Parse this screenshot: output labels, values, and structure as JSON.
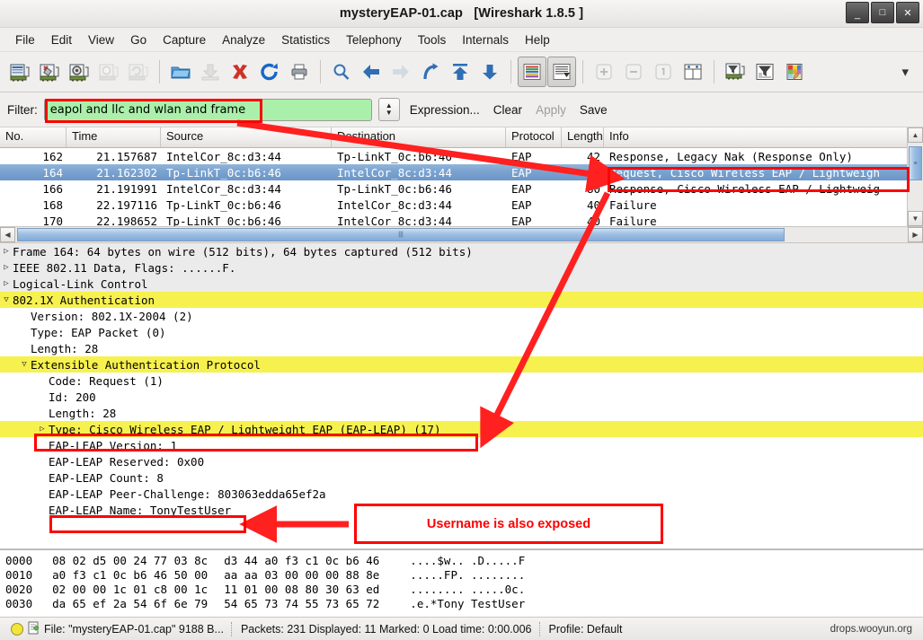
{
  "window": {
    "title": "mysteryEAP-01.cap   [Wireshark 1.8.5 ]",
    "minimize": "_",
    "maximize": "□",
    "close": "✕"
  },
  "menubar": {
    "items": [
      "File",
      "Edit",
      "View",
      "Go",
      "Capture",
      "Analyze",
      "Statistics",
      "Telephony",
      "Tools",
      "Internals",
      "Help"
    ]
  },
  "toolbar": {
    "icons": [
      "interfaces-icon",
      "capture-options-icon",
      "start-capture-icon",
      "stop-capture-icon",
      "restart-capture-icon",
      "open-file-icon",
      "save-file-icon",
      "close-file-icon",
      "reload-icon",
      "print-icon",
      "find-packet-icon",
      "go-back-icon",
      "go-forward-icon",
      "go-to-packet-icon",
      "go-first-packet-icon",
      "go-last-packet-icon",
      "colorize-icon",
      "auto-scroll-icon",
      "zoom-in-icon",
      "zoom-out-icon",
      "zoom-normal-icon",
      "resize-columns-icon",
      "capture-filters-icon",
      "display-filters-icon",
      "coloring-rules-icon"
    ],
    "overflow": "chevron-down-icon"
  },
  "filterbar": {
    "label": "Filter:",
    "value": "eapol and llc and wlan and frame",
    "placeholder": "",
    "expression": "Expression...",
    "clear": "Clear",
    "apply": "Apply",
    "save": "Save"
  },
  "packet_list": {
    "columns": [
      "No.",
      "Time",
      "Source",
      "Destination",
      "Protocol",
      "Length",
      "Info"
    ],
    "rows": [
      {
        "no": "162",
        "time": "21.157687",
        "source": "IntelCor_8c:d3:44",
        "destination": "Tp-LinkT_0c:b6:46",
        "protocol": "EAP",
        "length": "42",
        "info": "Response, Legacy Nak (Response Only)",
        "selected": false
      },
      {
        "no": "164",
        "time": "21.162302",
        "source": "Tp-LinkT_0c:b6:46",
        "destination": "IntelCor_8c:d3:44",
        "protocol": "EAP",
        "length": "64",
        "info": "Request, Cisco Wireless EAP / Lightweigh",
        "selected": true
      },
      {
        "no": "166",
        "time": "21.191991",
        "source": "IntelCor_8c:d3:44",
        "destination": "Tp-LinkT_0c:b6:46",
        "protocol": "EAP",
        "length": "80",
        "info": "Response, Cisco Wireless EAP / Lightweig",
        "selected": false
      },
      {
        "no": "168",
        "time": "22.197116",
        "source": "Tp-LinkT_0c:b6:46",
        "destination": "IntelCor_8c:d3:44",
        "protocol": "EAP",
        "length": "40",
        "info": "Failure",
        "selected": false
      },
      {
        "no": "170",
        "time": "22.198652",
        "source": "Tp-LinkT_0c:b6:46",
        "destination": "IntelCor_8c:d3:44",
        "protocol": "EAP",
        "length": "40",
        "info": "Failure",
        "selected": false
      }
    ]
  },
  "detail_tree": {
    "rows": [
      {
        "text": "Frame 164: 64 bytes on wire (512 bits), 64 bytes captured (512 bits)",
        "twisty": "collapsed",
        "indent": 0,
        "style": "band"
      },
      {
        "text": "IEEE 802.11 Data, Flags: ......F.",
        "twisty": "collapsed",
        "indent": 0,
        "style": "band"
      },
      {
        "text": "Logical-Link Control",
        "twisty": "collapsed",
        "indent": 0,
        "style": "band"
      },
      {
        "text": "802.1X Authentication",
        "twisty": "expanded",
        "indent": 0,
        "style": "yellow"
      },
      {
        "text": "Version: 802.1X-2004 (2)",
        "twisty": "none",
        "indent": 1,
        "style": "plain"
      },
      {
        "text": "Type: EAP Packet (0)",
        "twisty": "none",
        "indent": 1,
        "style": "plain"
      },
      {
        "text": "Length: 28",
        "twisty": "none",
        "indent": 1,
        "style": "plain"
      },
      {
        "text": "Extensible Authentication Protocol",
        "twisty": "expanded",
        "indent": 1,
        "style": "yellow"
      },
      {
        "text": "Code: Request (1)",
        "twisty": "none",
        "indent": 2,
        "style": "plain"
      },
      {
        "text": "Id: 200",
        "twisty": "none",
        "indent": 2,
        "style": "plain"
      },
      {
        "text": "Length: 28",
        "twisty": "none",
        "indent": 2,
        "style": "plain"
      },
      {
        "text": "Type: Cisco Wireless EAP / Lightweight EAP (EAP-LEAP) (17)",
        "twisty": "collapsed",
        "indent": 2,
        "style": "yellow"
      },
      {
        "text": "EAP-LEAP Version: 1",
        "twisty": "none",
        "indent": 2,
        "style": "plain"
      },
      {
        "text": "EAP-LEAP Reserved: 0x00",
        "twisty": "none",
        "indent": 2,
        "style": "plain"
      },
      {
        "text": "EAP-LEAP Count: 8",
        "twisty": "none",
        "indent": 2,
        "style": "plain"
      },
      {
        "text": "EAP-LEAP Peer-Challenge: 803063edda65ef2a",
        "twisty": "none",
        "indent": 2,
        "style": "plain"
      },
      {
        "text": "EAP-LEAP Name: TonyTestUser",
        "twisty": "none",
        "indent": 2,
        "style": "plain"
      }
    ]
  },
  "bytes_pane": {
    "rows": [
      {
        "offset": "0000",
        "hex1": "08 02 d5 00 24 77 03 8c",
        "hex2": "d3 44 a0 f3 c1 0c b6 46",
        "ascii": "....$w.. .D.....F"
      },
      {
        "offset": "0010",
        "hex1": "a0 f3 c1 0c b6 46 50 00",
        "hex2": "aa aa 03 00 00 00 88 8e",
        "ascii": ".....FP. ........"
      },
      {
        "offset": "0020",
        "hex1": "02 00 00 1c 01 c8 00 1c",
        "hex2": "11 01 00 08 80 30 63 ed",
        "ascii": "........ .....0c."
      },
      {
        "offset": "0030",
        "hex1": "da 65 ef 2a 54 6f 6e 79",
        "hex2": "54 65 73 74 55 73 65 72",
        "ascii": ".e.*Tony TestUser"
      }
    ]
  },
  "statusbar": {
    "expert_icon": "expert-info-icon",
    "file_icon": "capture-file-icon",
    "file": "File: \"mysteryEAP-01.cap\" 9188 B...",
    "packets": "Packets: 231 Displayed: 11 Marked: 0 Load time: 0:00.006",
    "profile": "Profile: Default",
    "watermark": "drops.wooyun.org"
  },
  "annotations": {
    "accent_color": "#ff0000",
    "callout_text": "Username is also exposed",
    "boxes": [
      {
        "name": "filter-value-highlight"
      },
      {
        "name": "info-column-highlight"
      },
      {
        "name": "leap-type-row-highlight"
      },
      {
        "name": "leap-name-row-highlight"
      }
    ],
    "arrows": [
      {
        "name": "arrow-filter-to-info"
      },
      {
        "name": "arrow-info-to-leap-type"
      },
      {
        "name": "arrow-callout-to-leap-name"
      }
    ]
  }
}
